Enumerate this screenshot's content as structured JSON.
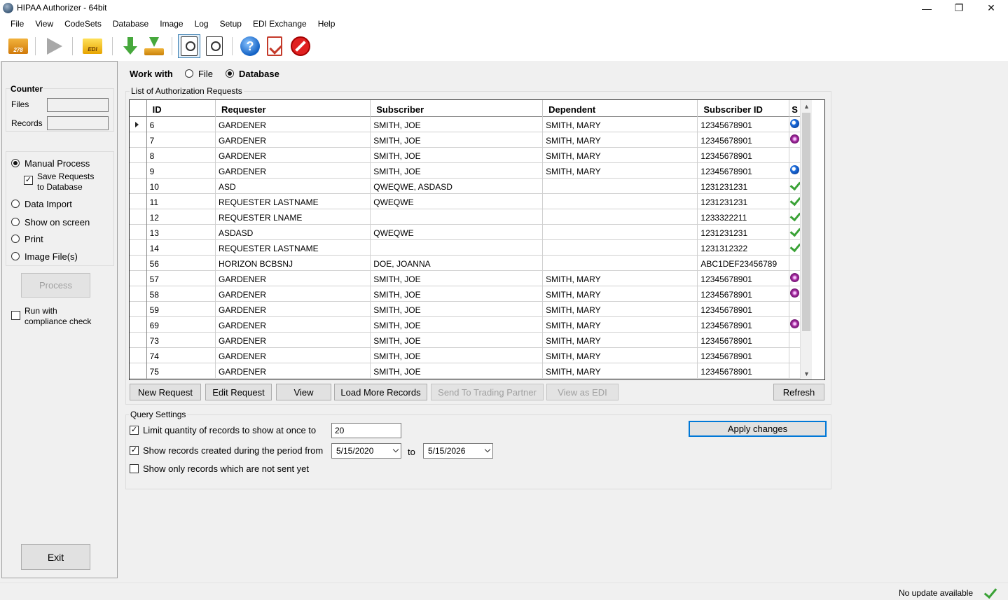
{
  "window": {
    "title": "HIPAA Authorizer - 64bit"
  },
  "menu": [
    "File",
    "View",
    "CodeSets",
    "Database",
    "Image",
    "Log",
    "Setup",
    "EDI Exchange",
    "Help"
  ],
  "toolbar": {
    "folder278_label": "278",
    "edi_label": "EDI",
    "help_label": "?"
  },
  "left": {
    "counter_title": "Counter",
    "files_label": "Files",
    "records_label": "Records",
    "manual_process": "Manual Process",
    "save_requests_line1": "Save Requests",
    "save_requests_line2": "to Database",
    "data_import": "Data Import",
    "show_on_screen": "Show on screen",
    "print": "Print",
    "image_files": "Image File(s)",
    "process_button": "Process",
    "run_with_line1": "Run with",
    "run_with_line2": "compliance check",
    "exit_button": "Exit",
    "selected_mode": "Manual Process",
    "save_requests_checked": true,
    "compliance_checked": false
  },
  "work_with": {
    "label": "Work with",
    "file_option": "File",
    "database_option": "Database",
    "selected": "Database"
  },
  "list": {
    "legend": "List of Authorization Requests",
    "columns": [
      "ID",
      "Requester",
      "Subscriber",
      "Dependent",
      "Subscriber ID",
      "S"
    ],
    "rows": [
      {
        "id": "6",
        "requester": "GARDENER",
        "subscriber": "SMITH, JOE",
        "dependent": "SMITH, MARY",
        "subscriber_id": "12345678901",
        "status": "blue"
      },
      {
        "id": "7",
        "requester": "GARDENER",
        "subscriber": "SMITH, JOE",
        "dependent": "SMITH, MARY",
        "subscriber_id": "12345678901",
        "status": "purple"
      },
      {
        "id": "8",
        "requester": "GARDENER",
        "subscriber": "SMITH, JOE",
        "dependent": "SMITH, MARY",
        "subscriber_id": "12345678901",
        "status": ""
      },
      {
        "id": "9",
        "requester": "GARDENER",
        "subscriber": "SMITH, JOE",
        "dependent": "SMITH, MARY",
        "subscriber_id": "12345678901",
        "status": "blue"
      },
      {
        "id": "10",
        "requester": "ASD",
        "subscriber": "QWEQWE, ASDASD",
        "dependent": "",
        "subscriber_id": "1231231231",
        "status": "check"
      },
      {
        "id": "11",
        "requester": "REQUESTER LASTNAME",
        "subscriber": "QWEQWE",
        "dependent": "",
        "subscriber_id": "1231231231",
        "status": "check"
      },
      {
        "id": "12",
        "requester": "REQUESTER LNAME",
        "subscriber": "",
        "dependent": "",
        "subscriber_id": "1233322211",
        "status": "check"
      },
      {
        "id": "13",
        "requester": "ASDASD",
        "subscriber": "QWEQWE",
        "dependent": "",
        "subscriber_id": "1231231231",
        "status": "check"
      },
      {
        "id": "14",
        "requester": "REQUESTER LASTNAME",
        "subscriber": "",
        "dependent": "",
        "subscriber_id": "1231312322",
        "status": "check"
      },
      {
        "id": "56",
        "requester": "HORIZON BCBSNJ",
        "subscriber": "DOE, JOANNA",
        "dependent": "",
        "subscriber_id": "ABC1DEF23456789",
        "status": ""
      },
      {
        "id": "57",
        "requester": "GARDENER",
        "subscriber": "SMITH, JOE",
        "dependent": "SMITH, MARY",
        "subscriber_id": "12345678901",
        "status": "purple"
      },
      {
        "id": "58",
        "requester": "GARDENER",
        "subscriber": "SMITH, JOE",
        "dependent": "SMITH, MARY",
        "subscriber_id": "12345678901",
        "status": "purple"
      },
      {
        "id": "59",
        "requester": "GARDENER",
        "subscriber": "SMITH, JOE",
        "dependent": "SMITH, MARY",
        "subscriber_id": "12345678901",
        "status": ""
      },
      {
        "id": "69",
        "requester": "GARDENER",
        "subscriber": "SMITH, JOE",
        "dependent": "SMITH, MARY",
        "subscriber_id": "12345678901",
        "status": "purple"
      },
      {
        "id": "73",
        "requester": "GARDENER",
        "subscriber": "SMITH, JOE",
        "dependent": "SMITH, MARY",
        "subscriber_id": "12345678901",
        "status": ""
      },
      {
        "id": "74",
        "requester": "GARDENER",
        "subscriber": "SMITH, JOE",
        "dependent": "SMITH, MARY",
        "subscriber_id": "12345678901",
        "status": ""
      },
      {
        "id": "75",
        "requester": "GARDENER",
        "subscriber": "SMITH, JOE",
        "dependent": "SMITH, MARY",
        "subscriber_id": "12345678901",
        "status": ""
      }
    ],
    "buttons": {
      "new_request": "New Request",
      "edit_request": "Edit Request",
      "view": "View",
      "load_more": "Load More Records",
      "send_to_partner": "Send To Trading Partner",
      "view_as_edi": "View as EDI",
      "refresh": "Refresh"
    }
  },
  "query": {
    "legend": "Query Settings",
    "limit_label": "Limit quantity of records to show at once to",
    "limit_value": "20",
    "limit_checked": true,
    "period_label": "Show records created during the period from",
    "period_checked": true,
    "date_from": "5/15/2020",
    "to_label": "to",
    "date_to": "5/15/2026",
    "not_sent_label": "Show only records which are not sent yet",
    "not_sent_checked": false,
    "apply_button": "Apply changes"
  },
  "status": {
    "text": "No update available"
  }
}
